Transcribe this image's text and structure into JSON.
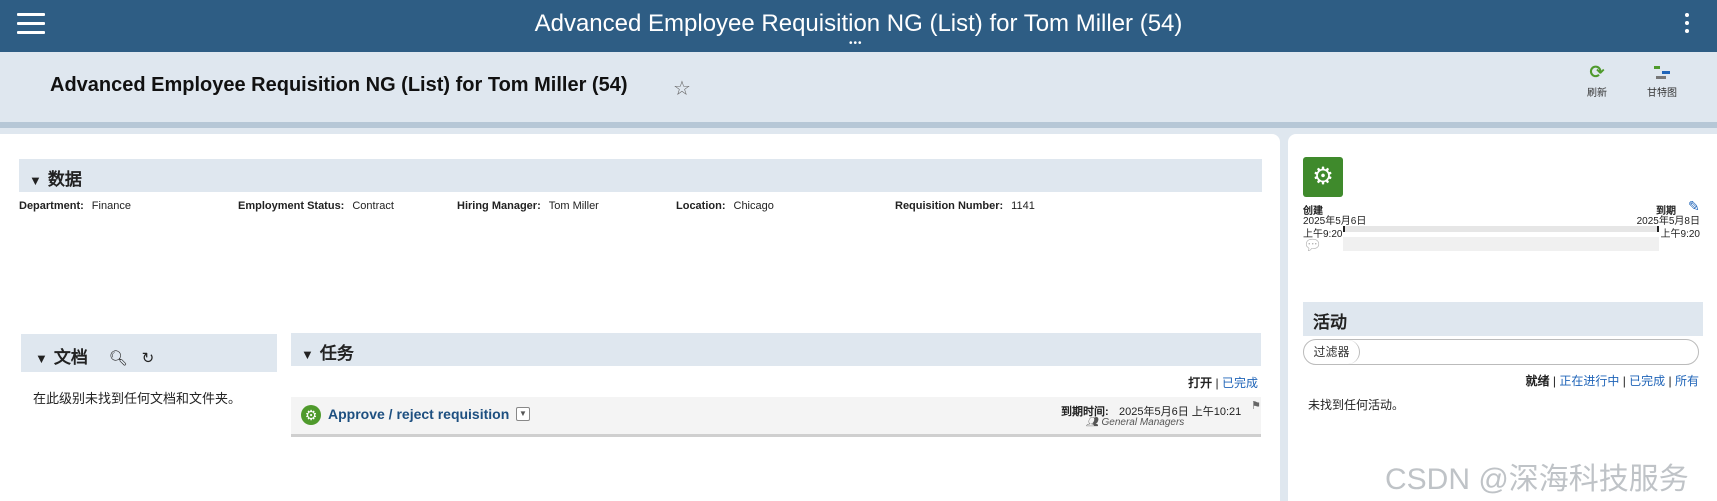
{
  "topbar": {
    "title": "Advanced Employee Requisition NG (List) for Tom Miller (54)"
  },
  "header": {
    "title": "Advanced Employee Requisition NG (List) for Tom Miller (54)",
    "refresh_label": "刷新",
    "gantt_label": "甘特图"
  },
  "data_section": {
    "title": "数据",
    "fields": [
      {
        "label": "Department:",
        "value": "Finance"
      },
      {
        "label": "Employment Status:",
        "value": "Contract"
      },
      {
        "label": "Hiring Manager:",
        "value": "Tom Miller"
      },
      {
        "label": "Location:",
        "value": "Chicago"
      },
      {
        "label": "Requisition Number:",
        "value": "1141"
      }
    ]
  },
  "documents": {
    "title": "文档",
    "empty_text": "在此级别未找到任何文档和文件夹。"
  },
  "tasks": {
    "title": "任务",
    "filter_open": "打开",
    "filter_done": "已完成",
    "items": [
      {
        "name": "Approve / reject requisition",
        "due_label": "到期时间:",
        "due": "2025年5月6日 上午10:21",
        "owner": "General Managers"
      }
    ]
  },
  "process": {
    "created_label": "创建",
    "created_date": "2025年5月6日",
    "created_time": "上午9:20",
    "due_label": "到期",
    "due_date": "2025年5月8日",
    "due_time": "上午9:20"
  },
  "activities": {
    "title": "活动",
    "filter_label": "过滤器",
    "filter_value": "",
    "tab_ready": "就绪",
    "tab_in_progress": "正在进行中",
    "tab_done": "已完成",
    "tab_all": "所有",
    "empty_text": "未找到任何活动。"
  },
  "watermark": "CSDN @深海科技服务",
  "colors": {
    "topbar": "#2e5d84",
    "accent_green": "#4f9a2c",
    "link": "#1f64b8"
  }
}
